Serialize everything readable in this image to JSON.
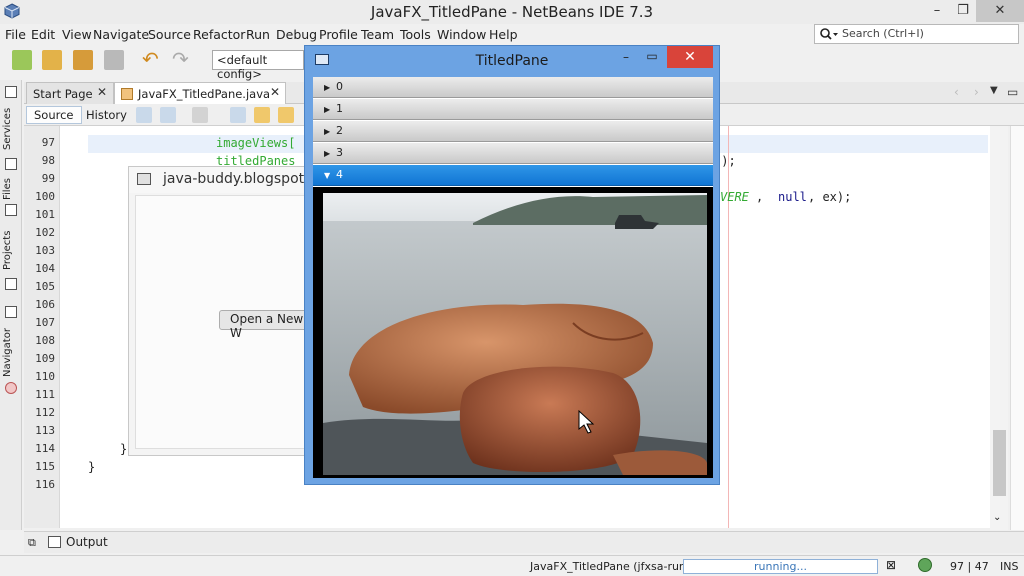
{
  "window": {
    "title": "JavaFX_TitledPane - NetBeans IDE 7.3"
  },
  "menu": [
    "File",
    "Edit",
    "View",
    "Navigate",
    "Source",
    "Refactor",
    "Run",
    "Debug",
    "Profile",
    "Team",
    "Tools",
    "Window",
    "Help"
  ],
  "search": {
    "placeholder": "Search (Ctrl+I)"
  },
  "toolbar": {
    "config": "<default config>"
  },
  "side_tabs": [
    "Services",
    "Files",
    "Projects",
    "Navigator"
  ],
  "editor_tabs": [
    {
      "label": "Start Page",
      "active": false
    },
    {
      "label": "JavaFX_TitledPane.java",
      "active": true
    }
  ],
  "editor_toolbar": {
    "source": "Source",
    "history": "History"
  },
  "line_numbers": [
    "97",
    "98",
    "99",
    "100",
    "101",
    "102",
    "103",
    "104",
    "105",
    "106",
    "107",
    "108",
    "109",
    "110",
    "111",
    "112",
    "113",
    "114",
    "115",
    "116"
  ],
  "code": {
    "l97": "imageViews[",
    "l98": "titledPanes",
    "l98_tail": "]);",
    "l100_a": "VERE",
    "l100_b": ", ",
    "l100_c": "null",
    "l100_d": ", ex);",
    "l114": "}",
    "l115": "}"
  },
  "background_window": {
    "title": "java-buddy.blogspot.c",
    "button": "Open a New W"
  },
  "titled_window": {
    "title": "TitledPane",
    "panes": [
      {
        "label": "0",
        "expanded": false
      },
      {
        "label": "1",
        "expanded": false
      },
      {
        "label": "2",
        "expanded": false
      },
      {
        "label": "3",
        "expanded": false
      },
      {
        "label": "4",
        "expanded": true
      }
    ]
  },
  "output": {
    "label": "Output"
  },
  "status": {
    "task": "JavaFX_TitledPane (jfxsa-run)",
    "progress": "running...",
    "position": "97 | 47",
    "mode": "INS"
  },
  "colors": {
    "titlebar_active": "#6ca3e3",
    "pane_selected": "#1e86dd",
    "close_red": "#d9443a"
  }
}
